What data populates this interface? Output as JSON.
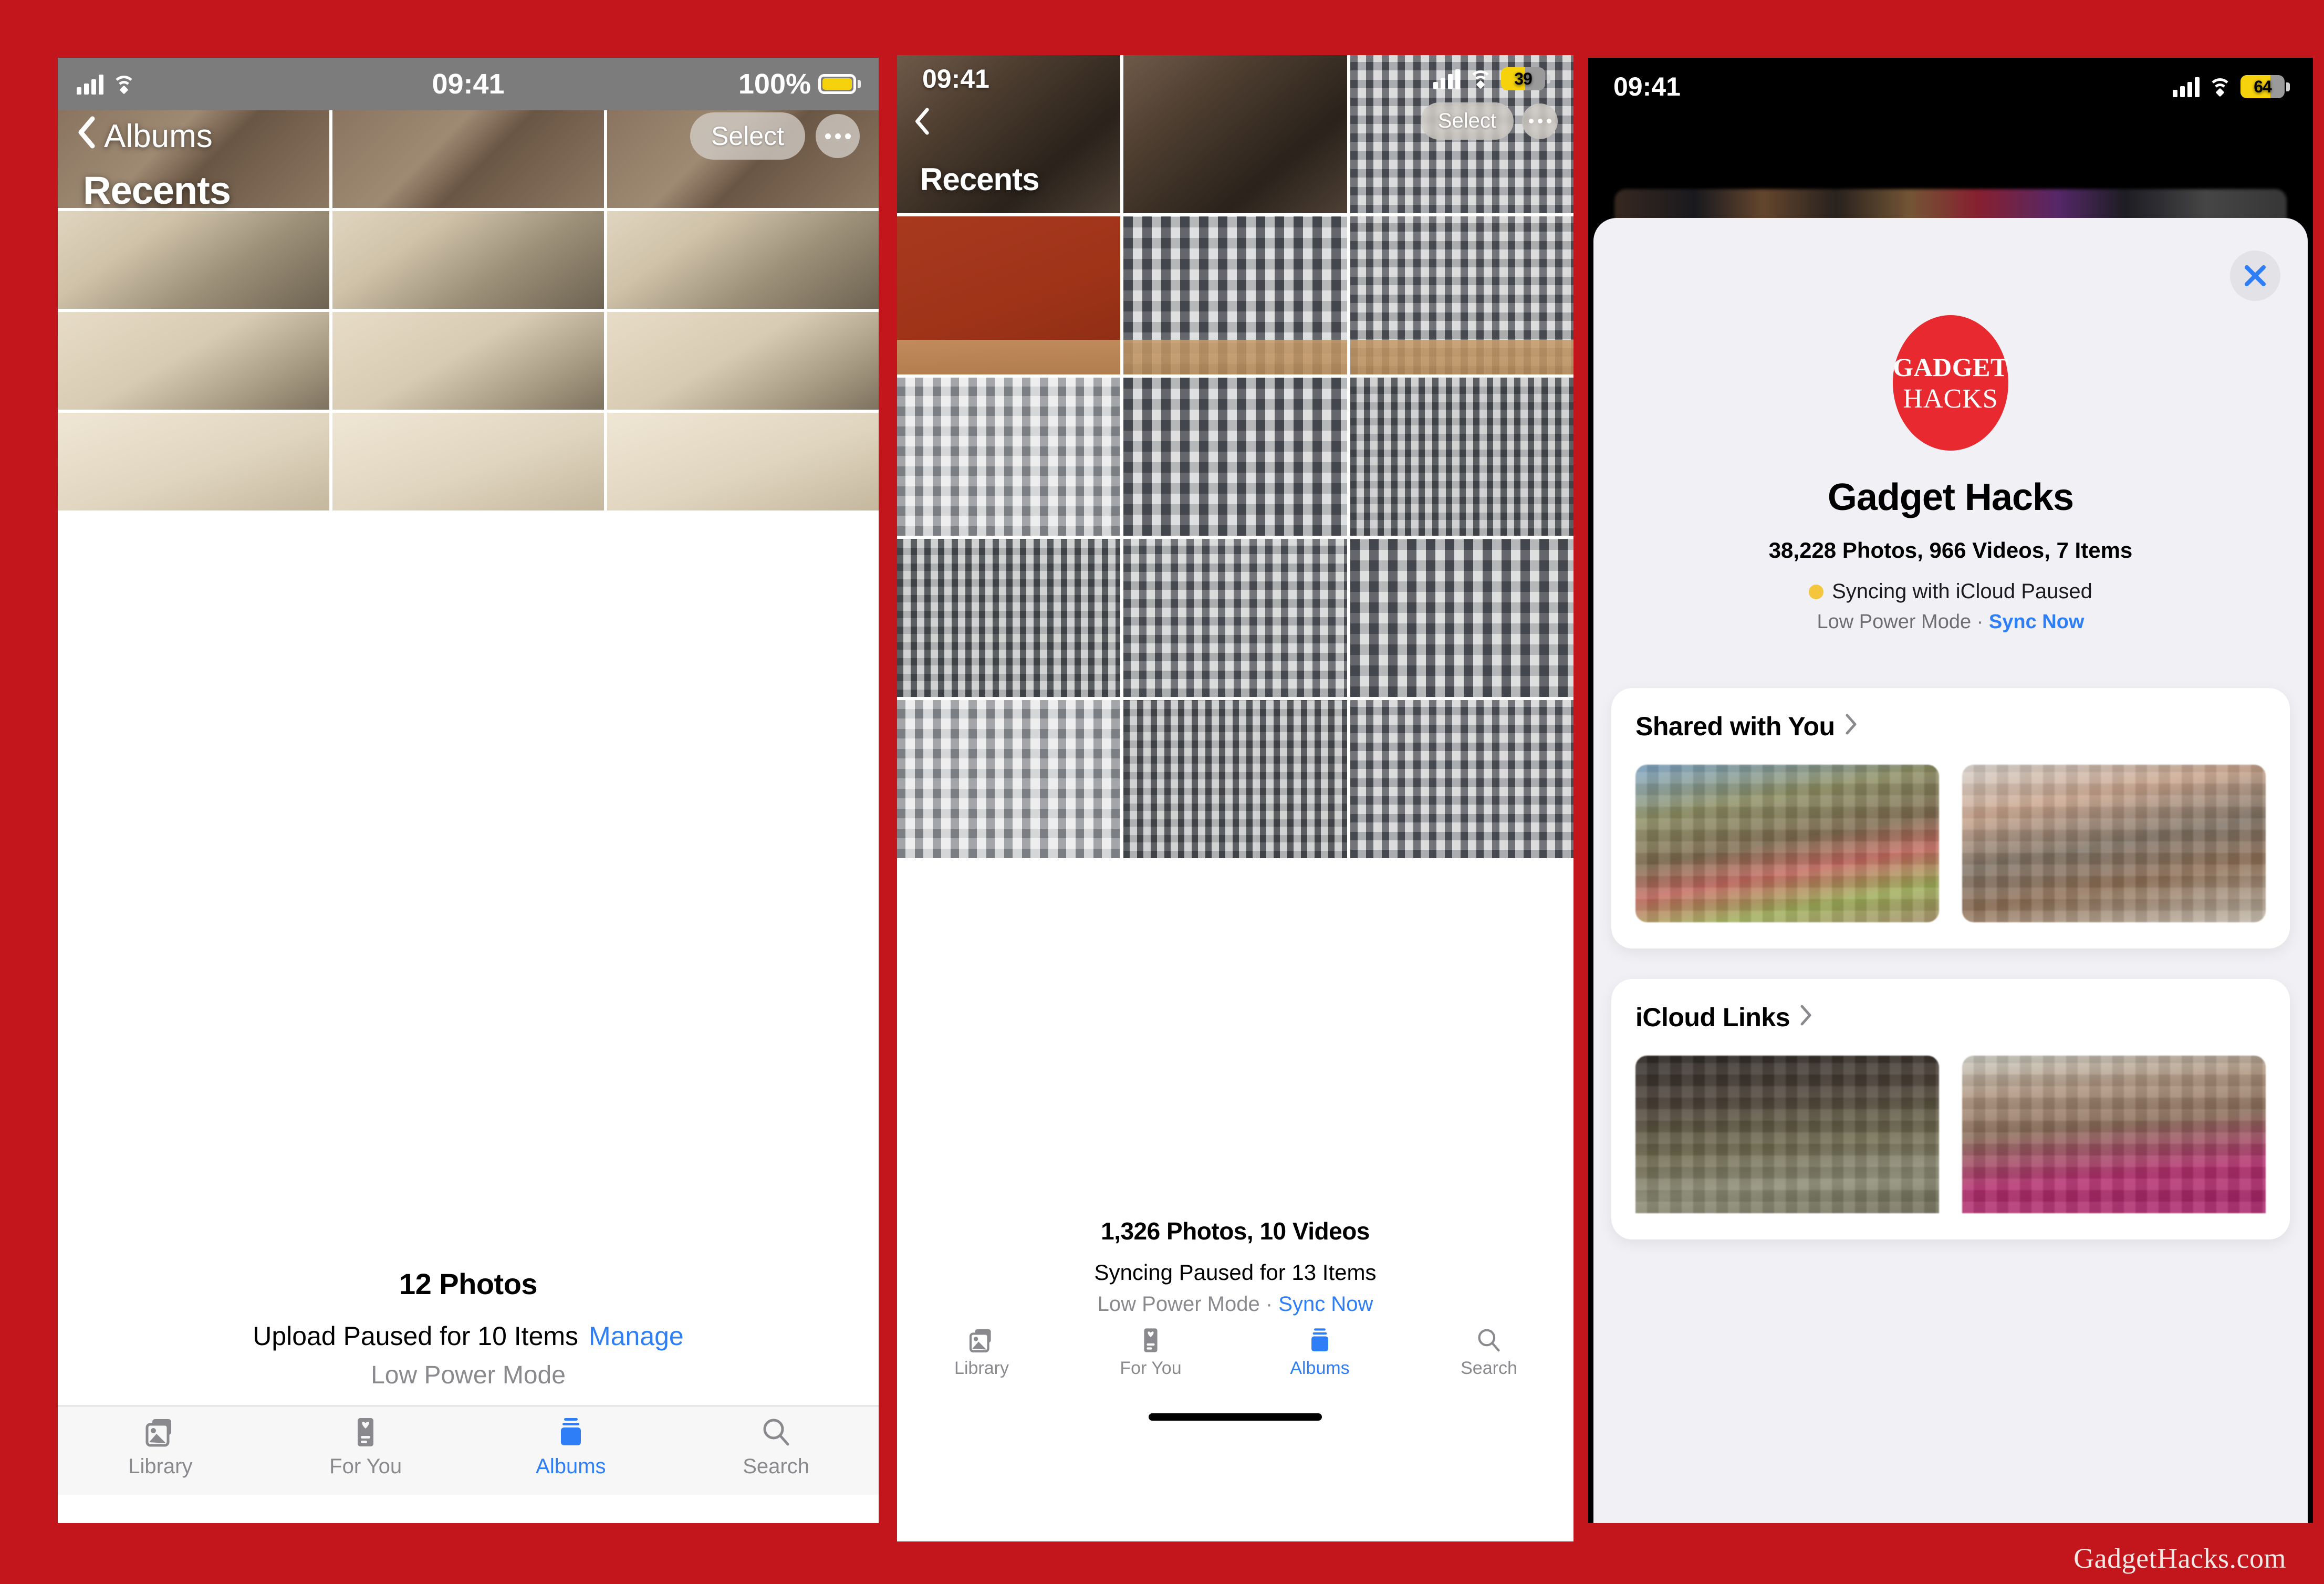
{
  "brand": {
    "accent_red": "#c3161c",
    "ios_blue": "#2d7ef7",
    "watermark": "GadgetHacks.com"
  },
  "panel1": {
    "status": {
      "time": "09:41",
      "battery_label": "100%"
    },
    "nav": {
      "back_label": "Albums",
      "title": "Recents",
      "select_label": "Select",
      "more_label": "•••"
    },
    "footer": {
      "count": "12 Photos",
      "status_text": "Upload Paused for 10 Items",
      "manage_label": "Manage",
      "sub_text": "Low Power Mode"
    },
    "tabs": [
      {
        "label": "Library",
        "icon": "photos-stack-icon",
        "active": false
      },
      {
        "label": "For You",
        "icon": "for-you-card-icon",
        "active": false
      },
      {
        "label": "Albums",
        "icon": "albums-stack-icon",
        "active": true
      },
      {
        "label": "Search",
        "icon": "search-icon",
        "active": false
      }
    ]
  },
  "panel2": {
    "status": {
      "time": "09:41",
      "battery_label": "39"
    },
    "nav": {
      "back_label": "",
      "title": "Recents",
      "select_label": "Select",
      "more_label": "•••"
    },
    "footer": {
      "count": "1,326 Photos, 10 Videos",
      "status_text": "Syncing Paused for 13 Items",
      "sub_prefix": "Low Power Mode · ",
      "sync_now_label": "Sync Now"
    },
    "tabs": [
      {
        "label": "Library",
        "icon": "photos-stack-icon",
        "active": false
      },
      {
        "label": "For You",
        "icon": "for-you-card-icon",
        "active": false
      },
      {
        "label": "Albums",
        "icon": "albums-stack-icon",
        "active": true
      },
      {
        "label": "Search",
        "icon": "search-icon",
        "active": false
      }
    ]
  },
  "panel3": {
    "status": {
      "time": "09:41",
      "battery_label": "64"
    },
    "sheet": {
      "close_label": "×",
      "logo": {
        "line1": "GADGET",
        "line2": "HACKS",
        "color": "#e8292f"
      },
      "account_name": "Gadget Hacks",
      "library_meta": "38,228 Photos, 966 Videos, 7 Items",
      "sync_status": "Syncing with iCloud Paused",
      "sync_dot_color": "#f3c63c",
      "sub_prefix": "Low Power Mode · ",
      "sync_now_label": "Sync Now",
      "cards": [
        {
          "title": "Shared with You",
          "thumb_count": 2
        },
        {
          "title": "iCloud Links",
          "thumb_count": 2
        }
      ]
    }
  }
}
